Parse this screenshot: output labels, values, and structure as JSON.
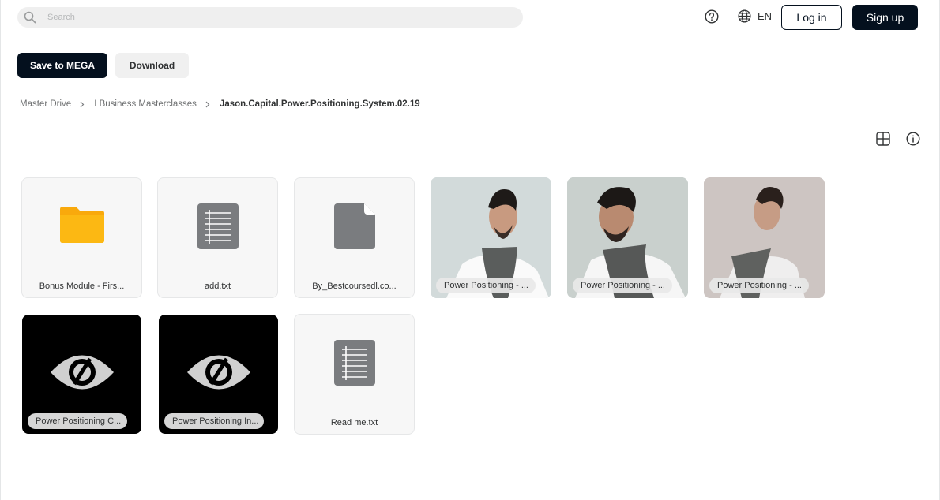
{
  "header": {
    "search_placeholder": "Search",
    "language": "EN",
    "login_label": "Log in",
    "signup_label": "Sign up"
  },
  "actions": {
    "save_label": "Save to MEGA",
    "download_label": "Download"
  },
  "breadcrumb": {
    "items": [
      "Master Drive",
      "I Business Masterclasses",
      "Jason.Capital.Power.Positioning.System.02.19"
    ]
  },
  "files": [
    {
      "name": "Bonus Module - Firs...",
      "kind": "folder"
    },
    {
      "name": "add.txt",
      "kind": "text"
    },
    {
      "name": "By_Bestcoursedl.co...",
      "kind": "generic"
    },
    {
      "name": "Power Positioning - ...",
      "kind": "photo"
    },
    {
      "name": "Power Positioning - ...",
      "kind": "photo"
    },
    {
      "name": "Power Positioning - ...",
      "kind": "photo"
    },
    {
      "name": "Power Positioning C...",
      "kind": "hidden-video"
    },
    {
      "name": "Power Positioning In...",
      "kind": "hidden-video"
    },
    {
      "name": "Read me.txt",
      "kind": "text"
    }
  ],
  "colors": {
    "brand_dark": "#04101e",
    "folder": "#f9a90c",
    "file_icon": "#7a7c7f"
  },
  "icons": {
    "search": "search-icon",
    "help": "help-circle-icon",
    "globe": "globe-icon",
    "chevron": "chevron-right-icon",
    "grid": "grid-view-icon",
    "info": "info-icon"
  }
}
